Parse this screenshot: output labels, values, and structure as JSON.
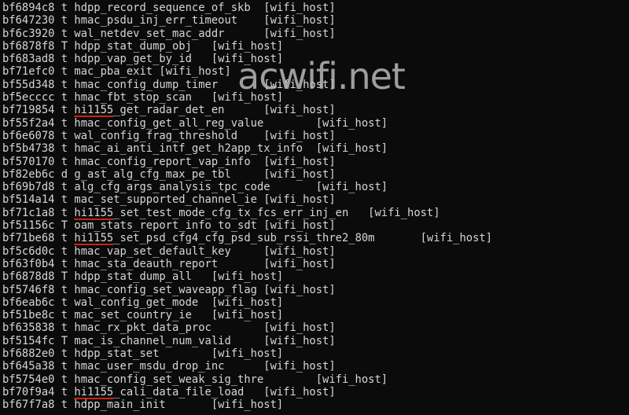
{
  "terminal": {
    "lines": [
      {
        "addr": "bf6894c8",
        "type": "t",
        "prefix": "",
        "symbol": "hdpp_record_sequence_of_skb",
        "sep": "\t",
        "module": "[wifi_host]"
      },
      {
        "addr": "bf647230",
        "type": "t",
        "prefix": "",
        "symbol": "hmac_psdu_inj_err_timeout",
        "sep": "\t",
        "module": "[wifi_host]"
      },
      {
        "addr": "bf6c3920",
        "type": "t",
        "prefix": "",
        "symbol": "wal_netdev_set_mac_addr",
        "sep": "\t",
        "module": "[wifi_host]"
      },
      {
        "addr": "bf6878f8",
        "type": "T",
        "prefix": "",
        "symbol": "hdpp_stat_dump_obj",
        "sep": "\t",
        "module": "[wifi_host]"
      },
      {
        "addr": "bf683ad8",
        "type": "t",
        "prefix": "",
        "symbol": "hdpp_vap_get_by_id",
        "sep": "\t",
        "module": "[wifi_host]"
      },
      {
        "addr": "bf71efc0",
        "type": "t",
        "prefix": "",
        "symbol": "mac_pba_exit",
        "sep": " ",
        "module": "[wifi_host]"
      },
      {
        "addr": "bf55d348",
        "type": "t",
        "prefix": "",
        "symbol": "hmac_config_dump_timer",
        "sep": "\t",
        "module": "[wifi_host]"
      },
      {
        "addr": "bf5ecccc",
        "type": "t",
        "prefix": "",
        "symbol": "hmac_fbt_stop_scan",
        "sep": "\t",
        "module": "[wifi_host]"
      },
      {
        "addr": "bf719854",
        "type": "t",
        "prefix": "hi1155",
        "symbol": "_get_radar_det_en",
        "sep": "\t",
        "module": "[wifi_host]"
      },
      {
        "addr": "bf55f2a4",
        "type": "t",
        "prefix": "",
        "symbol": "hmac_config_get_all_reg_value",
        "sep": "\t",
        "module": "[wifi_host]"
      },
      {
        "addr": "bf6e6078",
        "type": "t",
        "prefix": "",
        "symbol": "wal_config_frag_threshold",
        "sep": "\t",
        "module": "[wifi_host]"
      },
      {
        "addr": "bf5b4738",
        "type": "t",
        "prefix": "",
        "symbol": "hmac_ai_anti_intf_get_h2app_tx_info",
        "sep": "\t",
        "module": "[wifi_host]"
      },
      {
        "addr": "bf570170",
        "type": "t",
        "prefix": "",
        "symbol": "hmac_config_report_vap_info",
        "sep": "\t",
        "module": "[wifi_host]"
      },
      {
        "addr": "bf82eb6c",
        "type": "d",
        "prefix": "",
        "symbol": "g_ast_alg_cfg_max_pe_tbl",
        "sep": "\t",
        "module": "[wifi_host]"
      },
      {
        "addr": "bf69b7d8",
        "type": "t",
        "prefix": "",
        "symbol": "alg_cfg_args_analysis_tpc_code",
        "sep": "\t",
        "module": "[wifi_host]"
      },
      {
        "addr": "bf514a14",
        "type": "t",
        "prefix": "",
        "symbol": "mac_set_supported_channel_ie",
        "sep": " ",
        "module": "[wifi_host]"
      },
      {
        "addr": "bf71c1a8",
        "type": "t",
        "prefix": "hi1155",
        "symbol": "_set_test_mode_cfg_tx_fcs_err_inj_en",
        "sep": "\t",
        "module": "[wifi_host]"
      },
      {
        "addr": "bf51156c",
        "type": "T",
        "prefix": "",
        "symbol": "oam_stats_report_info_to_sdt",
        "sep": " ",
        "module": "[wifi_host]"
      },
      {
        "addr": "bf71be68",
        "type": "t",
        "prefix": "hi1155",
        "symbol": "_set_psd_cfg4_cfg_psd_sub_rssi_thre2_80m",
        "sep": "\t",
        "module": "[wifi_host]"
      },
      {
        "addr": "bf5c6d0c",
        "type": "t",
        "prefix": "",
        "symbol": "hmac_vap_set_default_key",
        "sep": "\t",
        "module": "[wifi_host]"
      },
      {
        "addr": "bf63f0b4",
        "type": "t",
        "prefix": "",
        "symbol": "hmac_sta_deauth_report",
        "sep": "\t",
        "module": "[wifi_host]"
      },
      {
        "addr": "bf6878d8",
        "type": "T",
        "prefix": "",
        "symbol": "hdpp_stat_dump_all",
        "sep": "\t",
        "module": "[wifi_host]"
      },
      {
        "addr": "bf5746f8",
        "type": "t",
        "prefix": "",
        "symbol": "hmac_config_set_waveapp_flag",
        "sep": " ",
        "module": "[wifi_host]"
      },
      {
        "addr": "bf6eab6c",
        "type": "t",
        "prefix": "",
        "symbol": "wal_config_get_mode",
        "sep": "\t",
        "module": "[wifi_host]"
      },
      {
        "addr": "bf51be8c",
        "type": "t",
        "prefix": "",
        "symbol": "mac_set_country_ie",
        "sep": "\t",
        "module": "[wifi_host]"
      },
      {
        "addr": "bf635838",
        "type": "t",
        "prefix": "",
        "symbol": "hmac_rx_pkt_data_proc",
        "sep": "\t",
        "module": "[wifi_host]"
      },
      {
        "addr": "bf5154fc",
        "type": "T",
        "prefix": "",
        "symbol": "mac_is_channel_num_valid",
        "sep": "\t",
        "module": "[wifi_host]"
      },
      {
        "addr": "bf6882e0",
        "type": "t",
        "prefix": "",
        "symbol": "hdpp_stat_set",
        "sep": "\t",
        "module": "[wifi_host]"
      },
      {
        "addr": "bf645a38",
        "type": "t",
        "prefix": "",
        "symbol": "hmac_user_msdu_drop_inc",
        "sep": "\t",
        "module": "[wifi_host]"
      },
      {
        "addr": "bf5754e0",
        "type": "t",
        "prefix": "",
        "symbol": "hmac_config_set_weak_sig_thre",
        "sep": "\t",
        "module": "[wifi_host]"
      },
      {
        "addr": "bf70f9a4",
        "type": "t",
        "prefix": "hi1155",
        "symbol": "_cali_data_file_load",
        "sep": "\t",
        "module": "[wifi_host]"
      },
      {
        "addr": "bf67f7a8",
        "type": "t",
        "prefix": "",
        "symbol": "hdpp_main_init",
        "sep": "\t",
        "module": "[wifi_host]"
      }
    ]
  },
  "watermark": "acwifi.net",
  "colors": {
    "background": "#0b0b0b",
    "text": "#d6d6d6",
    "underline": "#d0201a"
  }
}
